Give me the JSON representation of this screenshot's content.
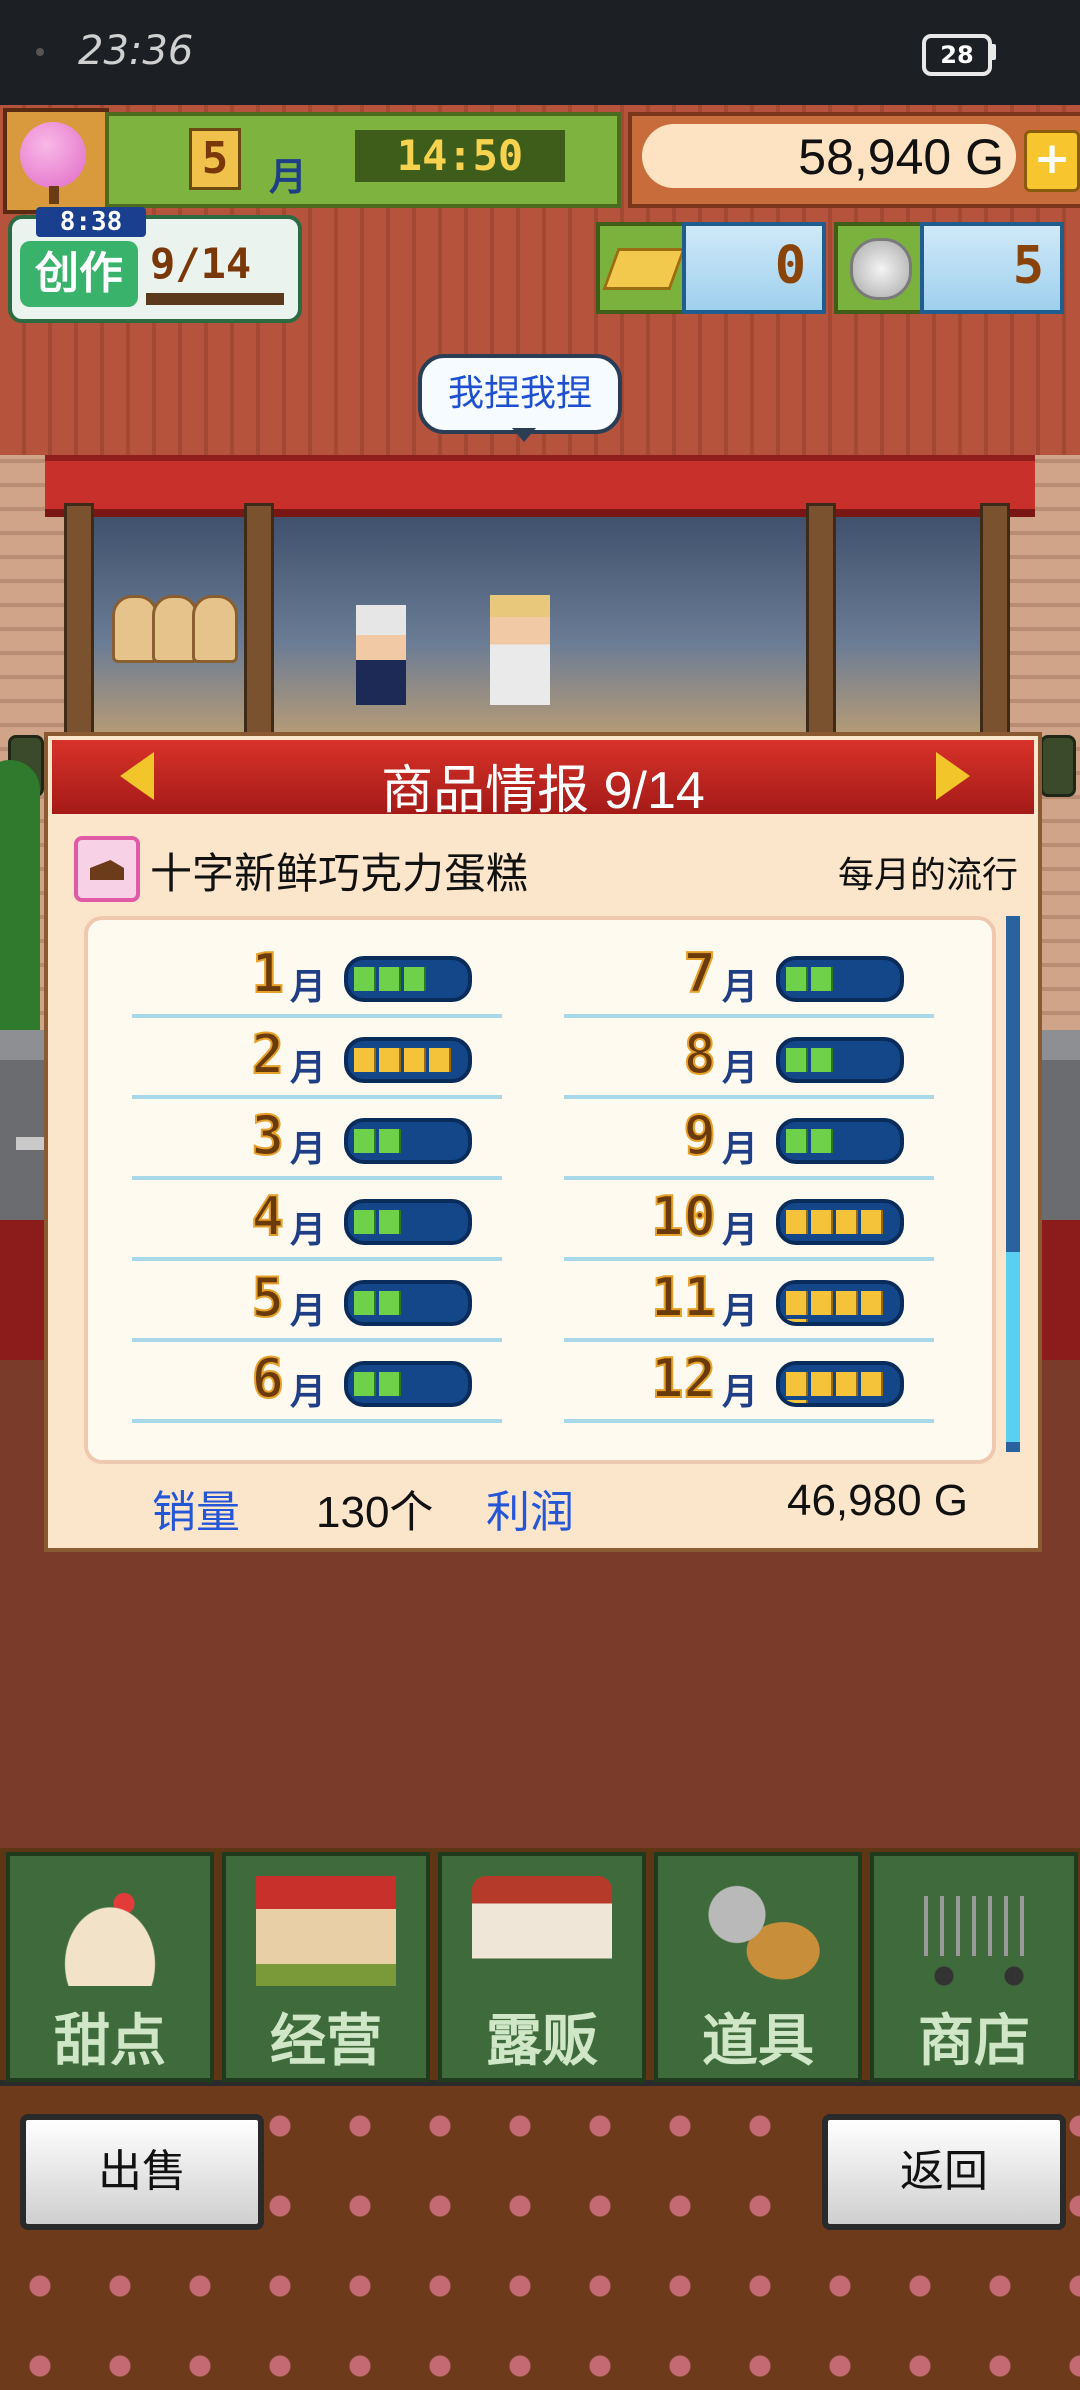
{
  "status_bar": {
    "time": "23:36",
    "battery": "28"
  },
  "hud": {
    "month_number": "5",
    "month_unit": "月",
    "clock": "14:50",
    "money": "58,940 G",
    "add_money": "+",
    "create": {
      "timer": "8:38",
      "label": "创作",
      "progress": "9/14"
    },
    "gold_bars": "0",
    "silver_coins": "5"
  },
  "speech_bubble": "我捏我捏",
  "product_panel": {
    "title": "商品情报 9/14",
    "product_name": "十字新鲜巧克力蛋糕",
    "trend_label": "每月的流行",
    "month_unit": "月",
    "months": [
      {
        "month": "1",
        "level": 3,
        "color": "green"
      },
      {
        "month": "2",
        "level": 4,
        "color": "yellow"
      },
      {
        "month": "3",
        "level": 2,
        "color": "green"
      },
      {
        "month": "4",
        "level": 2,
        "color": "green"
      },
      {
        "month": "5",
        "level": 2,
        "color": "green"
      },
      {
        "month": "6",
        "level": 2,
        "color": "green"
      },
      {
        "month": "7",
        "level": 2,
        "color": "green"
      },
      {
        "month": "8",
        "level": 2,
        "color": "green"
      },
      {
        "month": "9",
        "level": 2,
        "color": "green"
      },
      {
        "month": "10",
        "level": 4,
        "color": "yellow"
      },
      {
        "month": "11",
        "level": 5,
        "color": "yellow"
      },
      {
        "month": "12",
        "level": 5,
        "color": "yellow"
      }
    ],
    "sales_label": "销量",
    "sales_value": "130个",
    "profit_label": "利润",
    "profit_value": "46,980 G"
  },
  "nav": [
    "甜点",
    "经营",
    "露贩",
    "道具",
    "商店"
  ],
  "buttons": {
    "sell": "出售",
    "back": "返回"
  },
  "colors": {
    "meter_green": "#6fd14a",
    "meter_yellow": "#f5c33a",
    "panel_header": "#c8312b"
  }
}
